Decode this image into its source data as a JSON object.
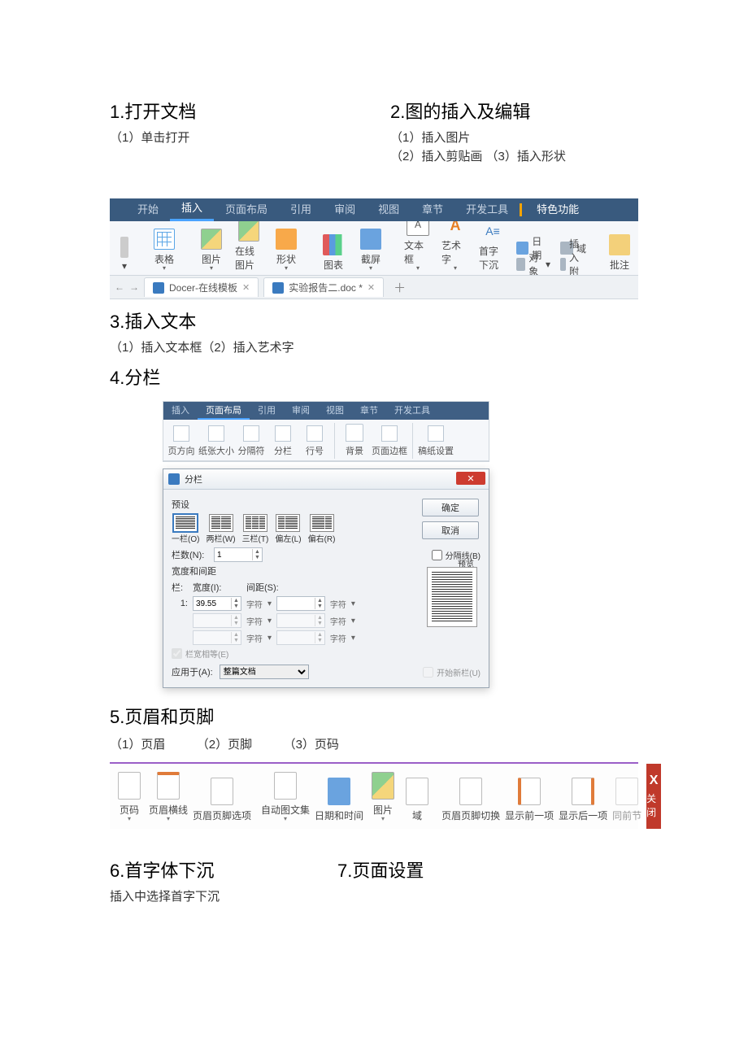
{
  "sections": {
    "s1_title": "1.打开文档",
    "s1_p1": "（1）单击打开",
    "s2_title": "2.图的插入及编辑",
    "s2_p1": "（1）插入图片",
    "s2_p2": "（2）插入剪贴画 （3）插入形状",
    "s3_title": "3.插入文本",
    "s3_p1": "（1）插入文本框（2）插入艺术字",
    "s4_title": "4.分栏",
    "s5_title": "5.页眉和页脚",
    "s5_p1": "（1）页眉",
    "s5_p2": "（2）页脚",
    "s5_p3": "（3）页码",
    "s6_title": "6.首字体下沉",
    "s6_p1": "插入中选择首字下沉",
    "s7_title": "7.页面设置"
  },
  "ribbon1": {
    "menu": [
      "开始",
      "插入",
      "页面布局",
      "引用",
      "审阅",
      "视图",
      "章节",
      "开发工具",
      "特色功能"
    ],
    "active": "插入",
    "tools": {
      "table": "表格",
      "pic": "图片",
      "onlinepic": "在线图片",
      "shape": "形状",
      "chart": "图表",
      "screenshot": "截屏",
      "textbox": "文本框",
      "wordart": "艺术字",
      "dropcap": "首字下沉",
      "object": "对象",
      "date": "日期",
      "field": "域",
      "attach": "插入附件",
      "comment": "批注"
    },
    "tabs": {
      "t1": "Docer-在线模板",
      "t2": "实验报告二.doc *"
    }
  },
  "ribbon2": {
    "menu": [
      "插入",
      "页面布局",
      "引用",
      "审阅",
      "视图",
      "章节",
      "开发工具"
    ],
    "active": "页面布局",
    "tools": {
      "orient": "页方向",
      "size": "纸张大小",
      "break": "分隔符",
      "columns": "分栏",
      "lineno": "行号",
      "bg": "背景",
      "border": "页面边框",
      "letterset": "稿纸设置"
    }
  },
  "dialog": {
    "title": "分栏",
    "preset_label": "预设",
    "presets": [
      "一栏(O)",
      "两栏(W)",
      "三栏(T)",
      "偏左(L)",
      "偏右(R)"
    ],
    "ok": "确定",
    "cancel": "取消",
    "cols_label": "栏数(N):",
    "cols_value": "1",
    "sep_line": "分隔线(B)",
    "width_gap": "宽度和间距",
    "preview": "预览",
    "col_hd": "栏:",
    "width_hd": "宽度(I):",
    "gap_hd": "间距(S):",
    "row1_col": "1:",
    "row1_width": "39.55",
    "unit": "字符",
    "equal": "栏宽相等(E)",
    "apply_label": "应用于(A):",
    "apply_value": "整篇文档",
    "new_col": "开始新栏(U)"
  },
  "ribbon3": {
    "items": {
      "pageno": "页码",
      "hline": "页眉横线",
      "hfopt": "页眉页脚选项",
      "autotext": "自动图文集",
      "datetime": "日期和时间",
      "pic": "图片",
      "field": "域",
      "hfswitch": "页眉页脚切换",
      "prev": "显示前一项",
      "next": "显示后一项",
      "same": "同前节",
      "close": "关闭"
    }
  }
}
